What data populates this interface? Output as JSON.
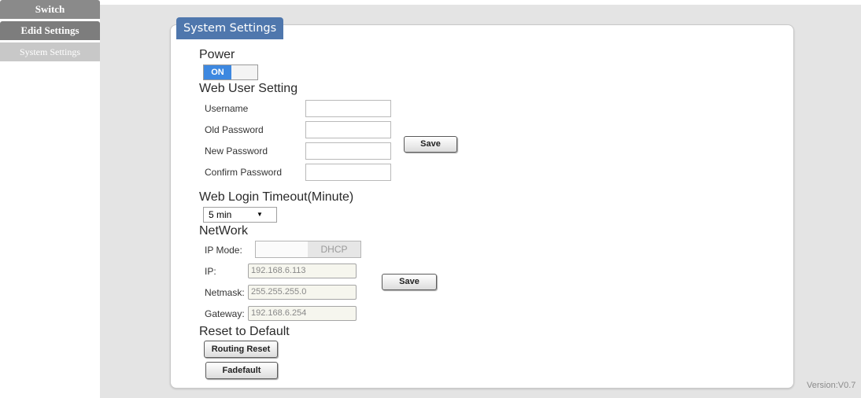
{
  "nav": {
    "items": [
      {
        "label": "Switch"
      },
      {
        "label": "Edid Settings"
      },
      {
        "label": "System Settings"
      }
    ]
  },
  "panel": {
    "title": "System Settings"
  },
  "power": {
    "title": "Power",
    "toggle_on_label": "ON"
  },
  "web_user": {
    "title": "Web User Setting",
    "username_label": "Username",
    "old_password_label": "Old Password",
    "new_password_label": "New Password",
    "confirm_password_label": "Confirm Password",
    "username_value": "",
    "old_password_value": "",
    "new_password_value": "",
    "confirm_password_value": "",
    "save_label": "Save"
  },
  "timeout": {
    "title": "Web Login Timeout(Minute)",
    "selected": "5 min"
  },
  "network": {
    "title": "NetWork",
    "ip_mode_label": "IP Mode:",
    "ip_mode_value": "DHCP",
    "ip_label": "IP:",
    "ip_value": "192.168.6.113",
    "netmask_label": "Netmask:",
    "netmask_value": "255.255.255.0",
    "gateway_label": "Gateway:",
    "gateway_value": "192.168.6.254",
    "save_label": "Save"
  },
  "reset": {
    "title": "Reset to Default",
    "routing_reset_label": "Routing Reset",
    "factory_default_label": "Fadefault"
  },
  "footer": {
    "version": "Version:V0.7"
  },
  "colors": {
    "tab_blue": "#4f77ad",
    "toggle_blue": "#3d88e0",
    "nav_gray": "#7d7d7d"
  }
}
